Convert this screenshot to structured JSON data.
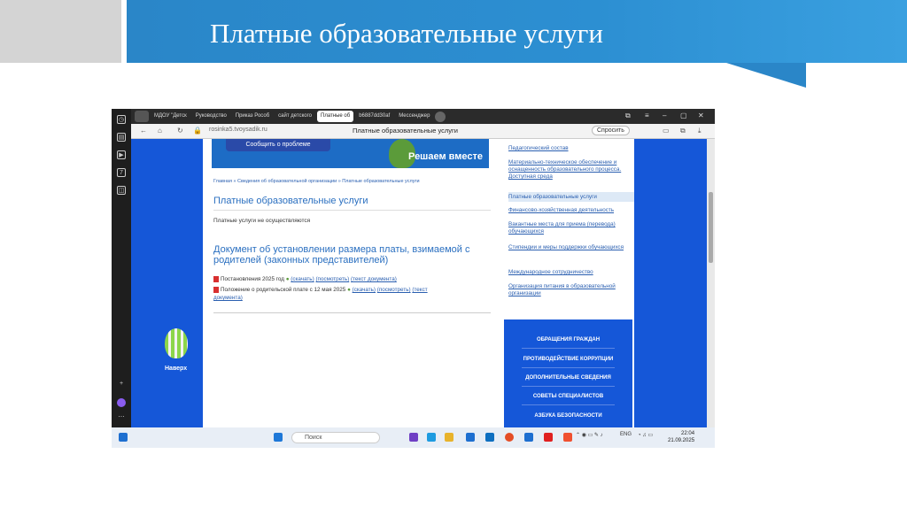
{
  "slide": {
    "title": "Платные образовательные услуги"
  },
  "browser": {
    "tabs": [
      "МДОУ \"Детск",
      "Руководство",
      "Приказ Рособ",
      "сайт детского",
      "Платные об",
      "b6887dd30af",
      "Мессенджер"
    ],
    "active_tab_index": 4,
    "url": "rosinka5.tvoysadik.ru",
    "page_title": "Платные образовательные услуги",
    "ask_button": "Спросить"
  },
  "page": {
    "banner_button": "Сообщить о проблеме",
    "banner_slogan": "Решаем вместе",
    "breadcrumbs": "Главная » Сведения об образовательной организации » Платные образовательные услуги",
    "heading": "Платные образовательные услуги",
    "note": "Платные услуги не осуществляются",
    "doc_heading": "Документ об установлении размера платы, взимаемой с родителей (законных представителей)",
    "doc1_name": "Постановления 2025 год",
    "doc2_name": "Положение о родительской плате с 12 мая 2025",
    "download": "(скачать)",
    "view": "(посмотреть)",
    "text_doc": "(текст документа)",
    "text_doc_short": "(текст",
    "text_doc_end": "документа)",
    "scroll_top": "Наверх"
  },
  "sidebar": {
    "links": [
      "Педагогический состав",
      "Материально-техническое обеспечение и оснащенность образовательного процесса. Доступная среда",
      "Платные образовательные услуги",
      "Финансово-хозяйственная деятельность",
      "Вакантные места для приема (перевода) обучающихся",
      "Стипендии и меры поддержки обучающихся",
      "Международное сотрудничество",
      "Организация питания в образовательной организации"
    ],
    "selected_index": 2,
    "menu": [
      "ОБРАЩЕНИЯ ГРАЖДАН",
      "ПРОТИВОДЕЙСТВИЕ КОРРУПЦИИ",
      "ДОПОЛНИТЕЛЬНЫЕ СВЕДЕНИЯ",
      "СОВЕТЫ СПЕЦИАЛИСТОВ",
      "АЗБУКА БЕЗОПАСНОСТИ"
    ]
  },
  "taskbar": {
    "search_placeholder": "Поиск",
    "lang": "ENG",
    "time": "22:04",
    "date": "21.09.2025"
  },
  "colors": {
    "accent": "#2a86c8",
    "site_blue": "#1557d8",
    "link": "#2a5fb0"
  }
}
